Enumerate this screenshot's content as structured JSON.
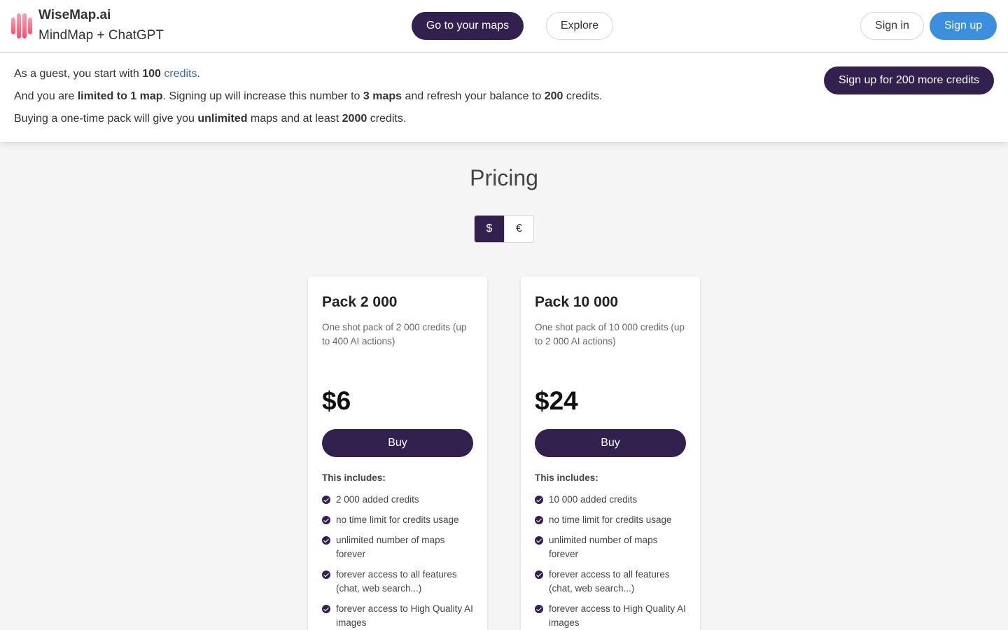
{
  "header": {
    "brand_name": "WiseMap.ai",
    "brand_tagline": "MindMap + ChatGPT",
    "go_to_maps": "Go to your maps",
    "explore": "Explore",
    "sign_in": "Sign in",
    "sign_up": "Sign up"
  },
  "notice": {
    "line1": {
      "pre": "As a guest, you start with ",
      "credits_count": "100",
      "space": " ",
      "credits_link": "credits",
      "end": "."
    },
    "line2": {
      "pre": "And you are ",
      "limit": "limited to 1 map",
      "mid1": ". Signing up will increase this number to ",
      "maps": "3 maps",
      "mid2": " and refresh your balance to ",
      "balance": "200",
      "end": " credits."
    },
    "line3": {
      "pre": "Buying a one-time pack will give you ",
      "unlimited": "unlimited",
      "mid": " maps and at least ",
      "amount": "2000",
      "end": " credits."
    },
    "cta": "Sign up for 200 more credits"
  },
  "pricing": {
    "title": "Pricing",
    "currencies": [
      "$",
      "€"
    ],
    "selected_currency": "$",
    "includes_label": "This includes:",
    "buy_label": "Buy",
    "plans": [
      {
        "name": "Pack 2 000",
        "description": "One shot pack of 2 000 credits (up to 400 AI actions)",
        "price": "$6",
        "features": [
          "2 000 added credits",
          "no time limit for credits usage",
          "unlimited number of maps forever",
          "forever access to all features (chat, web search...)",
          "forever access to High Quality AI images"
        ]
      },
      {
        "name": "Pack 10 000",
        "description": "One shot pack of 10 000 credits (up to 2 000 AI actions)",
        "price": "$24",
        "features": [
          "10 000 added credits",
          "no time limit for credits usage",
          "unlimited number of maps forever",
          "forever access to all features (chat, web search...)",
          "forever access to High Quality AI images"
        ]
      }
    ]
  },
  "colors": {
    "primary_dark": "#32204f",
    "signup_blue": "#3b8fdc",
    "link_blue": "#3a66b8",
    "logo_gradient": [
      "#ff4d6d",
      "#f7a1b6"
    ]
  }
}
